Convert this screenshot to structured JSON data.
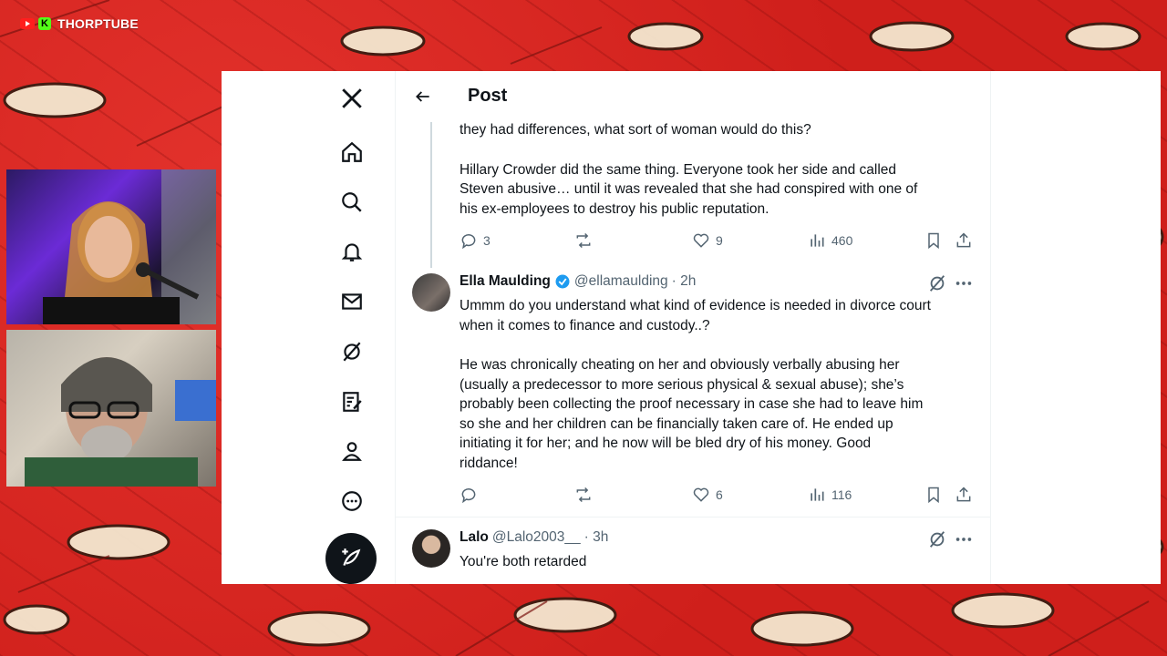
{
  "brand": {
    "name": "THORPTUBE",
    "icons": [
      "youtube-icon",
      "kick-icon"
    ]
  },
  "colors": {
    "accent": "#1d9bf0",
    "text": "#0f1419",
    "muted": "#536471",
    "verified": "#1d9bf0"
  },
  "header": {
    "title": "Post"
  },
  "nav": {
    "icons": [
      "x-logo-icon",
      "home-icon",
      "search-icon",
      "bell-icon",
      "mail-icon",
      "grok-icon",
      "notes-icon",
      "profile-icon",
      "more-icon",
      "compose-icon"
    ]
  },
  "posts": [
    {
      "text_lines": [
        "they had differences, what sort of woman would do this?",
        "",
        "Hillary Crowder did the same thing. Everyone took her side and called",
        "Steven abusive… until it was revealed that she had conspired with one of",
        "his ex-employees to destroy his public reputation."
      ],
      "stats": {
        "replies": "3",
        "reposts": "",
        "likes": "9",
        "views": "460"
      }
    },
    {
      "name": "Ella Maulding",
      "handle": "@ellamaulding",
      "time": "· 2h",
      "text_lines": [
        "Ummm do you understand what kind of evidence is needed in divorce court",
        "when it comes to finance and custody..?",
        "",
        "He was chronically cheating on her and obviously verbally abusing her",
        "(usually a predecessor to more serious physical & sexual abuse); she’s",
        "probably been collecting the proof necessary in case she had to leave him",
        "so she and her children can be financially taken care of. He ended up",
        "initiating it for her; and he now will be bled dry of his money. Good",
        "riddance!"
      ],
      "stats": {
        "replies": "",
        "reposts": "",
        "likes": "6",
        "views": "116"
      }
    },
    {
      "name": "Lalo",
      "handle": "@Lalo2003__",
      "time": "· 3h",
      "text_lines": [
        "You're both retarded"
      ]
    }
  ]
}
